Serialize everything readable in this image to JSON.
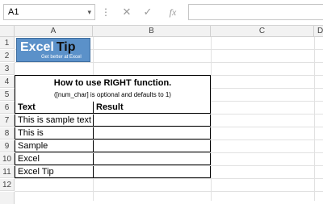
{
  "formula_bar": {
    "name_box": "A1",
    "dropdown_glyph": "▾",
    "more_glyph": "⋮",
    "cancel_glyph": "✕",
    "enter_glyph": "✓",
    "fx_label": "fx",
    "formula": ""
  },
  "columns": [
    "A",
    "B",
    "C",
    "D"
  ],
  "rows": [
    "1",
    "2",
    "3",
    "4",
    "5",
    "6",
    "7",
    "8",
    "9",
    "10",
    "11",
    "12"
  ],
  "logo": {
    "word1": "Excel",
    "word2": "Tip",
    "tagline": "Get better at Excel"
  },
  "table": {
    "title": "How to use RIGHT function.",
    "subtitle": "([num_char] is optional and defaults to 1)",
    "headers": {
      "text": "Text",
      "result": "Result"
    },
    "rows": [
      {
        "text": "This is sample text",
        "result": ""
      },
      {
        "text": "This is",
        "result": ""
      },
      {
        "text": "Sample",
        "result": ""
      },
      {
        "text": "Excel",
        "result": ""
      },
      {
        "text": "Excel Tip",
        "result": ""
      }
    ]
  },
  "colors": {
    "logo_bg": "#5b91c9",
    "header_bg": "#f2f2f2",
    "gridline": "#e1e1e1"
  }
}
